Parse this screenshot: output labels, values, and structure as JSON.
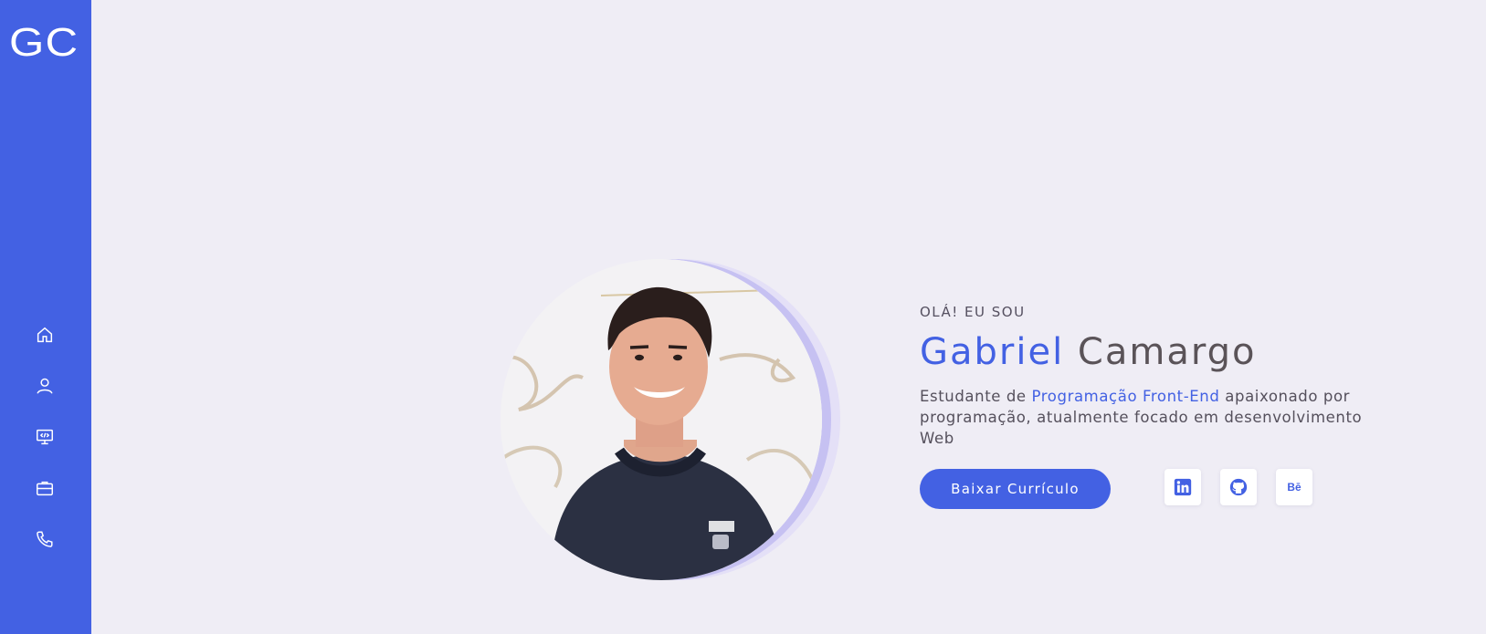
{
  "sidebar": {
    "logo": "GC",
    "items": [
      {
        "name": "home",
        "icon": "home-icon"
      },
      {
        "name": "about",
        "icon": "user-icon"
      },
      {
        "name": "skills",
        "icon": "monitor-code-icon"
      },
      {
        "name": "portfolio",
        "icon": "briefcase-icon"
      },
      {
        "name": "contact",
        "icon": "phone-icon"
      }
    ]
  },
  "hero": {
    "greeting": "OLÁ! EU SOU",
    "first_name": "Gabriel",
    "last_name": "Camargo",
    "description_prefix": "Estudante de ",
    "description_highlight": "Programação Front-End",
    "description_suffix": " apaixonado por programação, atualmente focado em desenvolvimento Web",
    "cv_button": "Baixar Currículo",
    "social": [
      {
        "name": "linkedin",
        "icon": "linkedin-icon",
        "label": "in"
      },
      {
        "name": "github",
        "icon": "github-icon"
      },
      {
        "name": "behance",
        "icon": "behance-icon",
        "label": "Bē"
      }
    ]
  },
  "colors": {
    "accent": "#4361e3",
    "background": "#efedf5",
    "ring_inner": "#c6c1f2",
    "ring_outer": "#e4e0f7"
  }
}
